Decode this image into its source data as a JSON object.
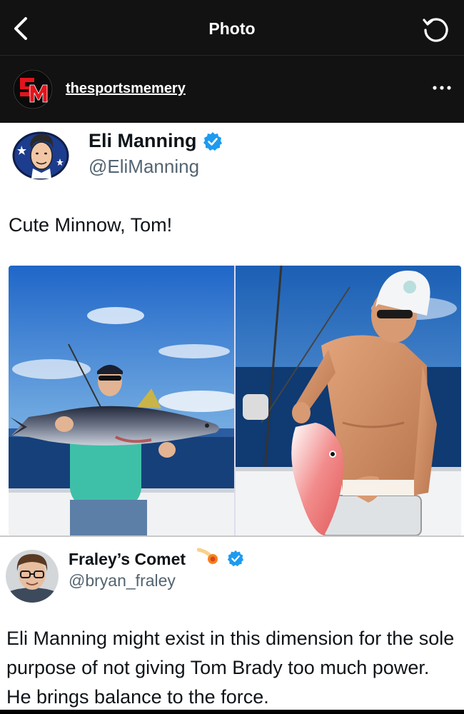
{
  "header": {
    "title": "Photo",
    "back_icon": "chevron-left-icon",
    "refresh_icon": "refresh-icon"
  },
  "account": {
    "username": "thesportsmemery",
    "avatar_letters": "SM",
    "more_icon": "more-horizontal-icon"
  },
  "tweet": {
    "name": "Eli Manning",
    "handle": "@EliManning",
    "verified_icon": "verified-badge-icon",
    "text": "Cute Minnow, Tom!"
  },
  "reply": {
    "name": "Fraley’s Comet",
    "handle": "@bryan_fraley",
    "emoji_icon": "comet-icon",
    "verified_icon": "verified-badge-icon",
    "text": "Eli Manning might exist in this dimension for the sole purpose of not giving Tom Brady too much power. He brings balance to the force."
  },
  "colors": {
    "header_bg": "#121212",
    "verified_blue": "#1d9bf0",
    "handle_gray": "#536471",
    "logo_red": "#e3141b"
  }
}
